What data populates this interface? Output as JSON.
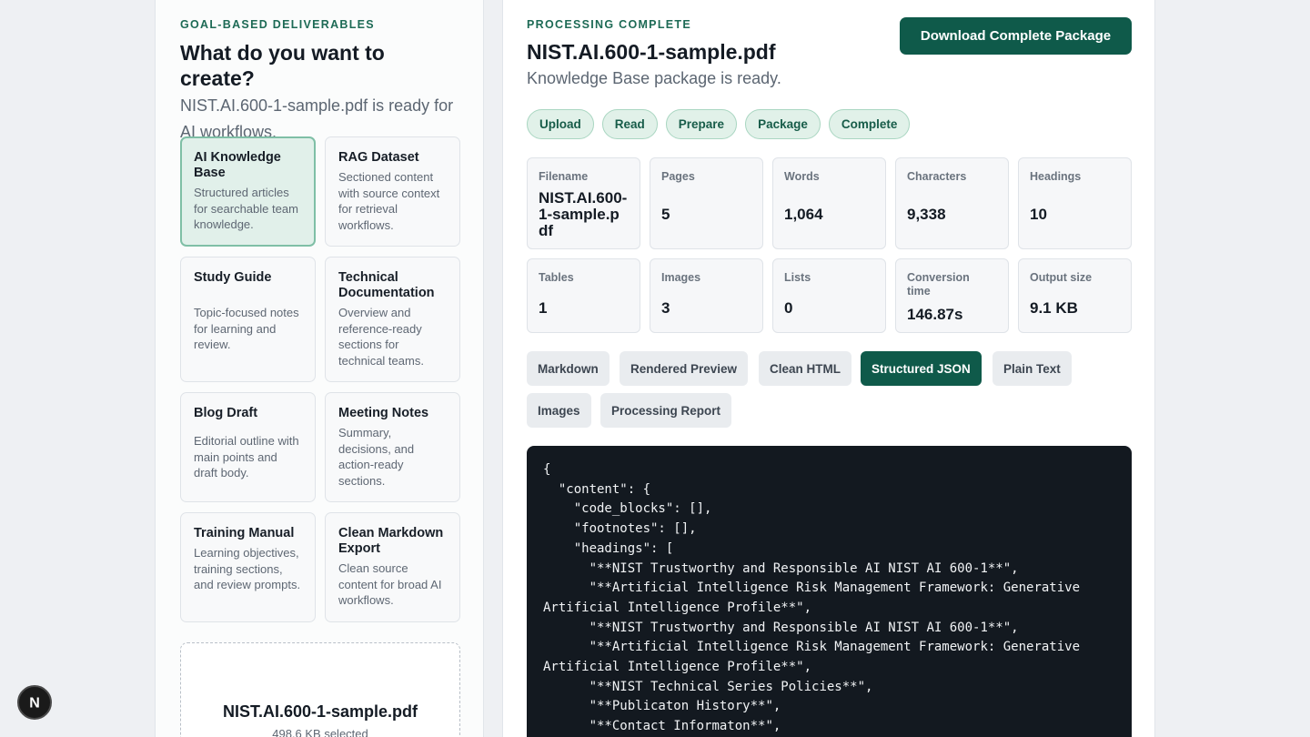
{
  "left": {
    "eyebrow": "GOAL-BASED DELIVERABLES",
    "title": "What do you want to create?",
    "subtitle": "NIST.AI.600-1-sample.pdf is ready for AI workflows.",
    "cards": [
      {
        "title": "AI Knowledge Base",
        "desc": "Structured articles for searchable team knowledge.",
        "selected": true
      },
      {
        "title": "RAG Dataset",
        "desc": "Sectioned content with source context for retrieval workflows."
      },
      {
        "title": "Study Guide",
        "desc": "Topic-focused notes for learning and review."
      },
      {
        "title": "Technical Documentation",
        "desc": "Overview and reference-ready sections for technical teams."
      },
      {
        "title": "Blog Draft",
        "desc": "Editorial outline with main points and draft body."
      },
      {
        "title": "Meeting Notes",
        "desc": "Summary, decisions, and action-ready sections."
      },
      {
        "title": "Training Manual",
        "desc": "Learning objectives, training sections, and review prompts."
      },
      {
        "title": "Clean Markdown Export",
        "desc": "Clean source content for broad AI workflows."
      }
    ],
    "dropzone": {
      "filename": "NIST.AI.600-1-sample.pdf",
      "size": "498.6 KB selected"
    }
  },
  "right": {
    "eyebrow": "PROCESSING COMPLETE",
    "title": "NIST.AI.600-1-sample.pdf",
    "subtitle": "Knowledge Base package is ready.",
    "download_label": "Download Complete Package",
    "steps": [
      "Upload",
      "Read",
      "Prepare",
      "Package",
      "Complete"
    ],
    "stats": [
      {
        "label": "Filename",
        "value": "NIST.AI.600-1-sample.pdf"
      },
      {
        "label": "Pages",
        "value": "5"
      },
      {
        "label": "Words",
        "value": "1,064"
      },
      {
        "label": "Characters",
        "value": "9,338"
      },
      {
        "label": "Headings",
        "value": "10"
      },
      {
        "label": "Tables",
        "value": "1"
      },
      {
        "label": "Images",
        "value": "3"
      },
      {
        "label": "Lists",
        "value": "0"
      },
      {
        "label": "Conversion time",
        "value": "146.87s"
      },
      {
        "label": "Output size",
        "value": "9.1 KB"
      }
    ],
    "tabs": [
      "Markdown",
      "Rendered Preview",
      "Clean HTML",
      "Structured JSON",
      "Plain Text",
      "Images",
      "Processing Report"
    ],
    "active_tab": "Structured JSON",
    "code": "{\n  \"content\": {\n    \"code_blocks\": [],\n    \"footnotes\": [],\n    \"headings\": [\n      \"**NIST Trustworthy and Responsible AI NIST AI 600-1**\",\n      \"**Artificial Intelligence Risk Management Framework: Generative Artificial Intelligence Profile**\",\n      \"**NIST Trustworthy and Responsible AI NIST AI 600-1**\",\n      \"**Artificial Intelligence Risk Management Framework: Generative Artificial Intelligence Profile**\",\n      \"**NIST Technical Series Policies**\",\n      \"**Publicaton History**\",\n      \"**Contact Informaton**\","
  },
  "fab": {
    "letter": "N"
  }
}
